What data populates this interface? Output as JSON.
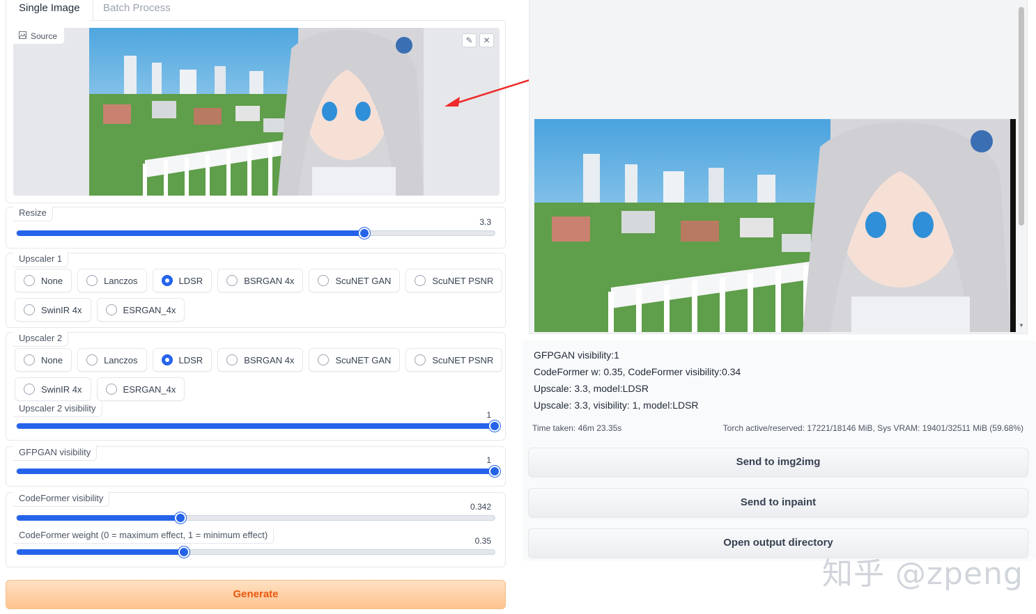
{
  "tabs": {
    "single": "Single Image",
    "batch": "Batch Process"
  },
  "source": {
    "label": "Source"
  },
  "resize": {
    "label": "Resize",
    "value": "3.3",
    "fraction": 0.727
  },
  "upscaler1": {
    "label": "Upscaler 1",
    "options": [
      "None",
      "Lanczos",
      "LDSR",
      "BSRGAN 4x",
      "ScuNET GAN",
      "ScuNET PSNR",
      "SwinIR 4x",
      "ESRGAN_4x"
    ],
    "selected": "LDSR"
  },
  "upscaler2": {
    "label": "Upscaler 2",
    "options": [
      "None",
      "Lanczos",
      "LDSR",
      "BSRGAN 4x",
      "ScuNET GAN",
      "ScuNET PSNR",
      "SwinIR 4x",
      "ESRGAN_4x"
    ],
    "selected": "LDSR"
  },
  "upscaler2_visibility": {
    "label": "Upscaler 2 visibility",
    "value": "1",
    "fraction": 1.0
  },
  "gfpgan": {
    "label": "GFPGAN visibility",
    "value": "1",
    "fraction": 1.0
  },
  "codeformer_visibility": {
    "label": "CodeFormer visibility",
    "value": "0.342",
    "fraction": 0.342
  },
  "codeformer_weight": {
    "label": "CodeFormer weight (0 = maximum effect, 1 = minimum effect)",
    "value": "0.35",
    "fraction": 0.35
  },
  "generate": {
    "label": "Generate"
  },
  "output": {
    "info": [
      "GFPGAN visibility:1",
      "CodeFormer w: 0.35, CodeFormer visibility:0.34",
      "Upscale: 3.3, model:LDSR",
      "Upscale: 3.3, visibility: 1, model:LDSR"
    ],
    "time_taken": "Time taken: 46m 23.35s",
    "vram": "Torch active/reserved: 17221/18146 MiB, Sys VRAM: 19401/32511 MiB (59.68%)"
  },
  "buttons": {
    "img2img": "Send to img2img",
    "inpaint": "Send to inpaint",
    "open_dir": "Open output directory"
  },
  "watermark": "知乎 @zpeng",
  "colors": {
    "accent": "#2563eb",
    "generate_text": "#ea580c",
    "generate_bg": "#fdc38f"
  }
}
